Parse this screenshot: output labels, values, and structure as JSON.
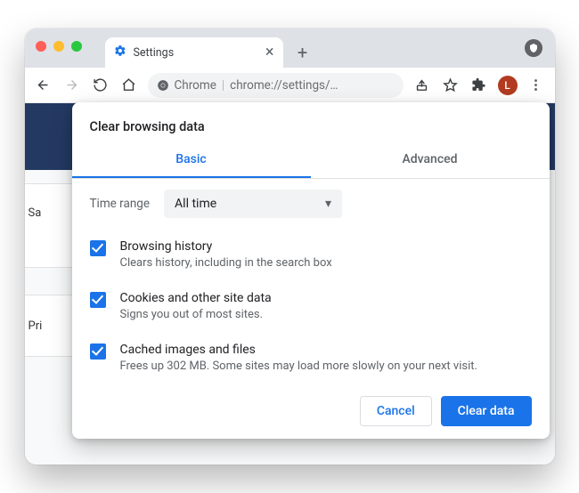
{
  "tabs": {
    "active": "Settings"
  },
  "toolbar": {
    "address_prefix": "Chrome",
    "address_url": "chrome://settings/…",
    "profile_letter": "L"
  },
  "bg": {
    "sidecard1": "Sa",
    "sidecard2": "Pri"
  },
  "dialog": {
    "title": "Clear browsing data",
    "tabs": [
      "Basic",
      "Advanced"
    ],
    "time_label": "Time range",
    "time_value": "All time",
    "items": [
      {
        "title": "Browsing history",
        "sub": "Clears history, including in the search box"
      },
      {
        "title": "Cookies and other site data",
        "sub": "Signs you out of most sites."
      },
      {
        "title": "Cached images and files",
        "sub": "Frees up 302 MB. Some sites may load more slowly on your next visit."
      }
    ],
    "cancel": "Cancel",
    "confirm": "Clear data"
  }
}
